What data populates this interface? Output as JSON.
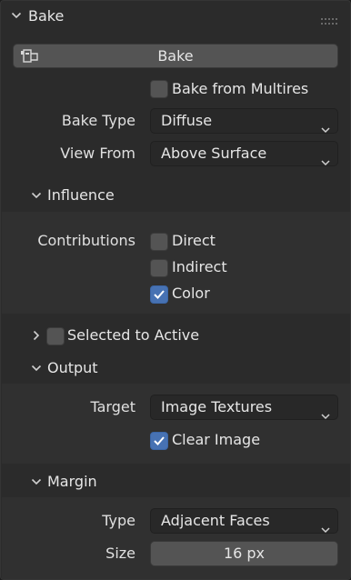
{
  "bake_panel": {
    "title": "Bake",
    "bake_button": "Bake",
    "bake_from_multires": {
      "label": "Bake from Multires",
      "checked": false
    },
    "bake_type": {
      "label": "Bake Type",
      "value": "Diffuse"
    },
    "view_from": {
      "label": "View From",
      "value": "Above Surface"
    }
  },
  "influence": {
    "title": "Influence",
    "contributions_label": "Contributions",
    "direct": {
      "label": "Direct",
      "checked": false
    },
    "indirect": {
      "label": "Indirect",
      "checked": false
    },
    "color": {
      "label": "Color",
      "checked": true
    }
  },
  "selected_to_active": {
    "label": "Selected to Active",
    "checked": false,
    "expanded": false
  },
  "output": {
    "title": "Output",
    "target": {
      "label": "Target",
      "value": "Image Textures"
    },
    "clear_image": {
      "label": "Clear Image",
      "checked": true
    }
  },
  "margin": {
    "title": "Margin",
    "type": {
      "label": "Type",
      "value": "Adjacent Faces"
    },
    "size": {
      "label": "Size",
      "value": "16 px"
    }
  },
  "colors": {
    "accent": "#4772b3",
    "panel": "#2b2b2b",
    "subpanel": "#303030",
    "field": "#282828",
    "button": "#545454"
  }
}
